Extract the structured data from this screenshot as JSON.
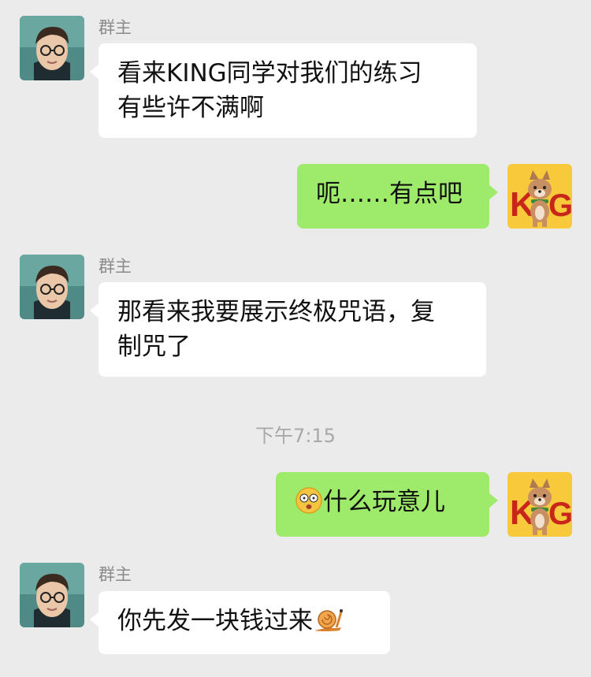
{
  "chat": {
    "time_divider": "下午7:15",
    "messages": [
      {
        "side": "left",
        "sender": "群主",
        "lines": [
          "看来KING同学对我们的练习",
          "有些许不满啊"
        ]
      },
      {
        "side": "right",
        "text": "呃……有点吧"
      },
      {
        "side": "left",
        "sender": "群主",
        "lines": [
          "那看来我要展示终极咒语，复",
          "制咒了"
        ]
      },
      {
        "side": "right",
        "emoji": "dizzy-face-emoji",
        "text": "什么玩意儿"
      },
      {
        "side": "left",
        "sender": "群主",
        "text": "你先发一块钱过来",
        "emoji": "snail-emoji"
      }
    ]
  },
  "avatars": {
    "group_owner": "harry-potter-photo-avatar",
    "user_badge_text": "KING"
  },
  "colors": {
    "background": "#ebebeb",
    "left_bubble": "#ffffff",
    "right_bubble": "#9eea6a",
    "sender_name": "#8a8a8a",
    "time_text": "#a8a8a8",
    "king_badge_bg": "#f7c93b",
    "king_badge_text": "#c8261b"
  }
}
